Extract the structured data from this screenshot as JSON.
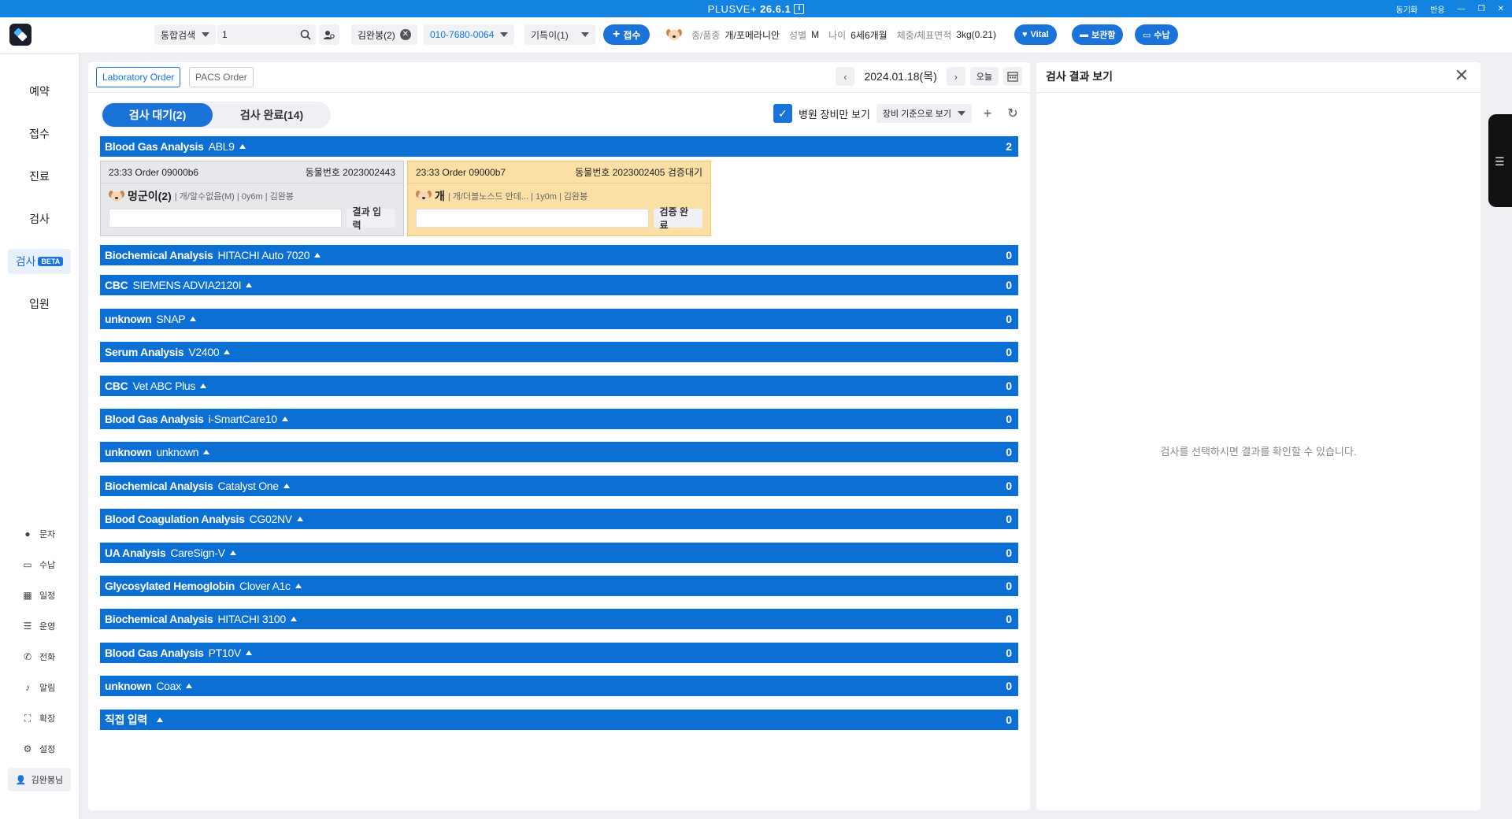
{
  "titlebar": {
    "title": "PLUSVE+ ",
    "version": "26.6.1",
    "info_icon": "i",
    "sync": "동기화",
    "response": "반응",
    "win_min": "—",
    "win_restore": "❐",
    "win_close": "✕"
  },
  "toolbar": {
    "search_type": "통합검색",
    "search_value": "1",
    "owner_chip": "김완봉(2)",
    "phone": "010-7680-0064",
    "pet_select": "기특이(1)",
    "reception_button": "접수",
    "species_label": "종/품종",
    "species_value": "개/포메라니안",
    "sex_label": "성별",
    "sex_value": "M",
    "age_label": "나이",
    "age_value": "6세6개월",
    "weight_label": "체중/체표면적",
    "weight_value": "3kg(0.21)",
    "vital_button": "Vital",
    "storage_button": "보관함",
    "payment_button": "수납"
  },
  "leftnav": {
    "items": [
      {
        "label": "예약"
      },
      {
        "label": "접수"
      },
      {
        "label": "진료"
      },
      {
        "label": "검사"
      },
      {
        "label": "검사",
        "badge": "BETA"
      },
      {
        "label": "입원"
      }
    ],
    "sub_items": [
      {
        "label": "문자",
        "icon": "chat-icon"
      },
      {
        "label": "수납",
        "icon": "card-icon"
      },
      {
        "label": "일정",
        "icon": "calendar-icon"
      },
      {
        "label": "운영",
        "icon": "list-icon"
      },
      {
        "label": "전화",
        "icon": "phone-icon"
      },
      {
        "label": "알림",
        "icon": "bell-icon"
      },
      {
        "label": "확장",
        "icon": "expand-icon"
      },
      {
        "label": "설정",
        "icon": "gear-icon"
      }
    ],
    "user": "김완봉님"
  },
  "main": {
    "tabs": [
      "Laboratory Order",
      "PACS Order"
    ],
    "date": "2024.01.18(목)",
    "today_button": "오늘",
    "segment": {
      "waiting": "검사 대기(2)",
      "done": "검사 완료(14)"
    },
    "hospital_only_label": "병원 장비만 보기",
    "view_select": "장비 기준으로 보기",
    "groups": [
      {
        "name": "Blood Gas Analysis",
        "model": "ABL9",
        "count": "2"
      },
      {
        "name": "Biochemical Analysis",
        "model": "HITACHI Auto 7020",
        "count": "0"
      },
      {
        "name": "CBC",
        "model": "SIEMENS ADVIA2120I",
        "count": "0"
      },
      {
        "name": "unknown",
        "model": "SNAP",
        "count": "0"
      },
      {
        "name": "Serum Analysis",
        "model": "V2400",
        "count": "0"
      },
      {
        "name": "CBC",
        "model": "Vet ABC Plus",
        "count": "0"
      },
      {
        "name": "Blood Gas Analysis",
        "model": "i-SmartCare10",
        "count": "0"
      },
      {
        "name": "unknown",
        "model": "unknown",
        "count": "0"
      },
      {
        "name": "Biochemical Analysis",
        "model": "Catalyst One",
        "count": "0"
      },
      {
        "name": "Blood Coagulation Analysis",
        "model": "CG02NV",
        "count": "0"
      },
      {
        "name": "UA Analysis",
        "model": "CareSign-V",
        "count": "0"
      },
      {
        "name": "Glycosylated Hemoglobin",
        "model": "Clover A1c",
        "count": "0"
      },
      {
        "name": "Biochemical Analysis",
        "model": "HITACHI 3100",
        "count": "0"
      },
      {
        "name": "Blood Gas Analysis",
        "model": "PT10V",
        "count": "0"
      },
      {
        "name": "unknown",
        "model": "Coax",
        "count": "0"
      },
      {
        "name": "직접 입력",
        "model": "",
        "count": "0"
      }
    ],
    "cards": [
      {
        "time_order": "23:33  Order 09000b6",
        "animal_no": "동물번호 2023002443",
        "status": "",
        "pet_name": "멍군이(2)",
        "details": "| 개/알수없음(M) | 0y6m | 김완봉",
        "action": "결과 입력"
      },
      {
        "time_order": "23:33  Order 09000b7",
        "animal_no": "동물번호 2023002405",
        "status": "검증대기",
        "pet_name": "개",
        "details": "| 개/더블노스드 안데... | 1y0m | 김완봉",
        "action": "검증 완료"
      }
    ]
  },
  "right_panel": {
    "title": "검사 결과 보기",
    "empty_message": "검사를 선택하시면 결과를 확인할 수 있습니다."
  }
}
